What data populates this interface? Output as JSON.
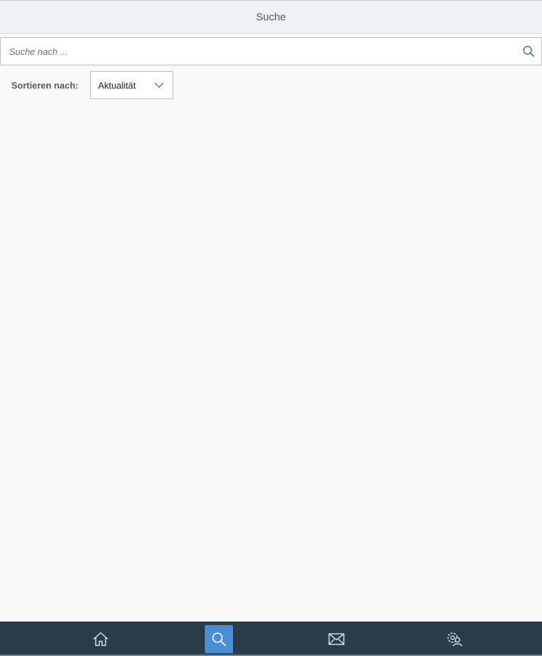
{
  "header": {
    "title": "Suche"
  },
  "search": {
    "placeholder": "Suche nach ...",
    "value": "",
    "icon": "search-icon"
  },
  "sort": {
    "label": "Sortieren nach:",
    "selected": "Aktualität",
    "icon": "chevron-down-icon"
  },
  "tabbar": {
    "items": [
      {
        "name": "home",
        "icon": "home-icon",
        "active": false
      },
      {
        "name": "search",
        "icon": "search-icon",
        "active": true
      },
      {
        "name": "messages",
        "icon": "mail-icon",
        "active": false
      },
      {
        "name": "settings",
        "icon": "user-settings-icon",
        "active": false
      }
    ]
  },
  "colors": {
    "header_bg": "#eef2f7",
    "tabbar_bg": "#2d3a48",
    "active_tab": "#4a8fd3",
    "page_bg": "#f9f9f9"
  }
}
